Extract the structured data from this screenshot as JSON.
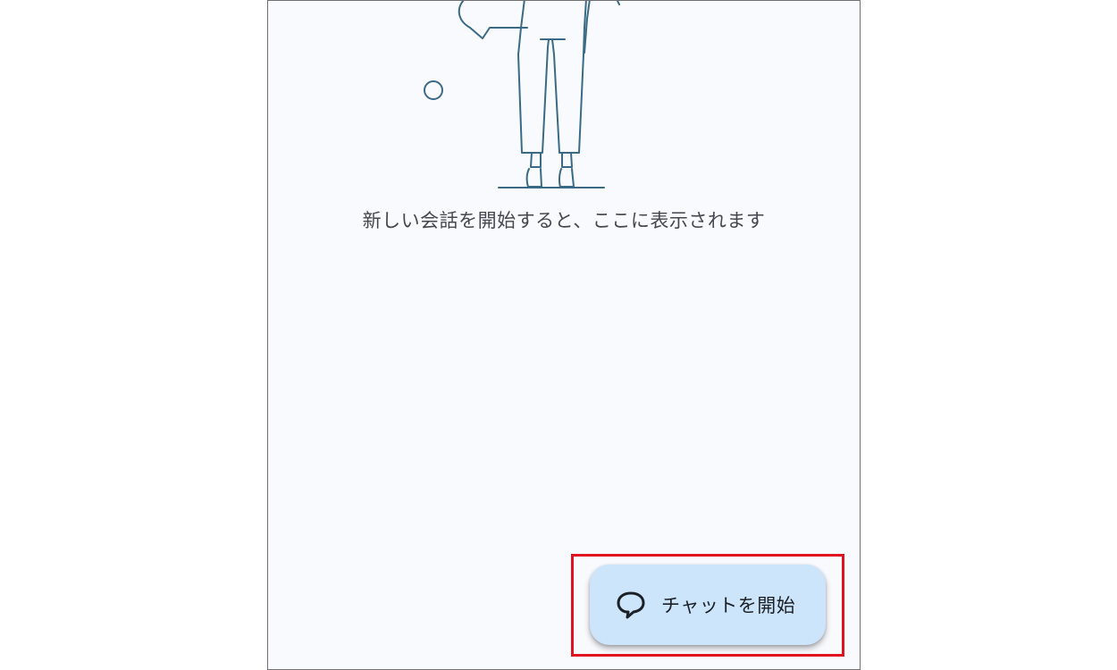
{
  "empty_state": {
    "message": "新しい会話を開始すると、ここに表示されます"
  },
  "fab": {
    "label": "チャットを開始",
    "icon": "chat-bubble-icon"
  },
  "colors": {
    "screen_bg": "#f9fafe",
    "illustration_stroke": "#3a6a86",
    "fab_bg": "#cce5fb",
    "highlight": "#e0141e"
  }
}
